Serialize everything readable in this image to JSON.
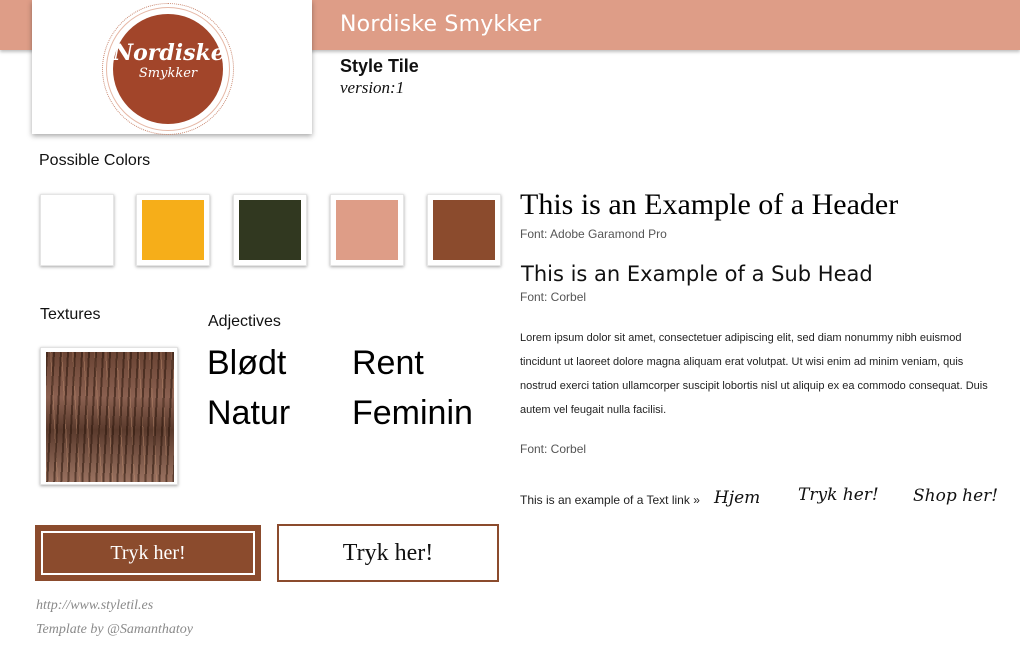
{
  "header": {
    "brand_title": "Nordiske Smykker",
    "logo_line1": "Nordiske",
    "logo_line2": "Smykker",
    "style_tile": "Style Tile",
    "version": "version:1"
  },
  "colors": {
    "label": "Possible Colors",
    "swatches": [
      "#ffffff",
      "#f6ae19",
      "#313820",
      "#de9d87",
      "#8b4b2d"
    ]
  },
  "textures": {
    "label": "Textures"
  },
  "adjectives": {
    "label": "Adjectives",
    "items": [
      "Blødt",
      "Rent",
      "Natur",
      "Feminin"
    ]
  },
  "typography": {
    "header_example": "This is an Example of a Header",
    "header_font": "Font: Adobe Garamond Pro",
    "subhead_example": "This is an Example of a Sub Head",
    "subhead_font": "Font: Corbel",
    "body_text": "Lorem ipsum dolor sit amet, consectetuer adipiscing elit, sed diam nonummy nibh euismod tincidunt ut laoreet dolore magna aliquam erat volutpat. Ut wisi enim ad minim veniam, quis nostrud exerci tation ullamcorper suscipit lobortis nisl ut aliquip ex ea commodo consequat. Duis autem vel feugait nulla facilisi.",
    "body_font": "Font: Corbel"
  },
  "links": {
    "label": "This is an example of a Text link »",
    "items": [
      "Hjem",
      "Tryk her!",
      "Shop her!"
    ]
  },
  "buttons": {
    "filled": "Tryk her!",
    "outline": "Tryk her!"
  },
  "footer": {
    "url": "http://www.styletil.es",
    "credit": "Template by @Samanthatoy"
  }
}
